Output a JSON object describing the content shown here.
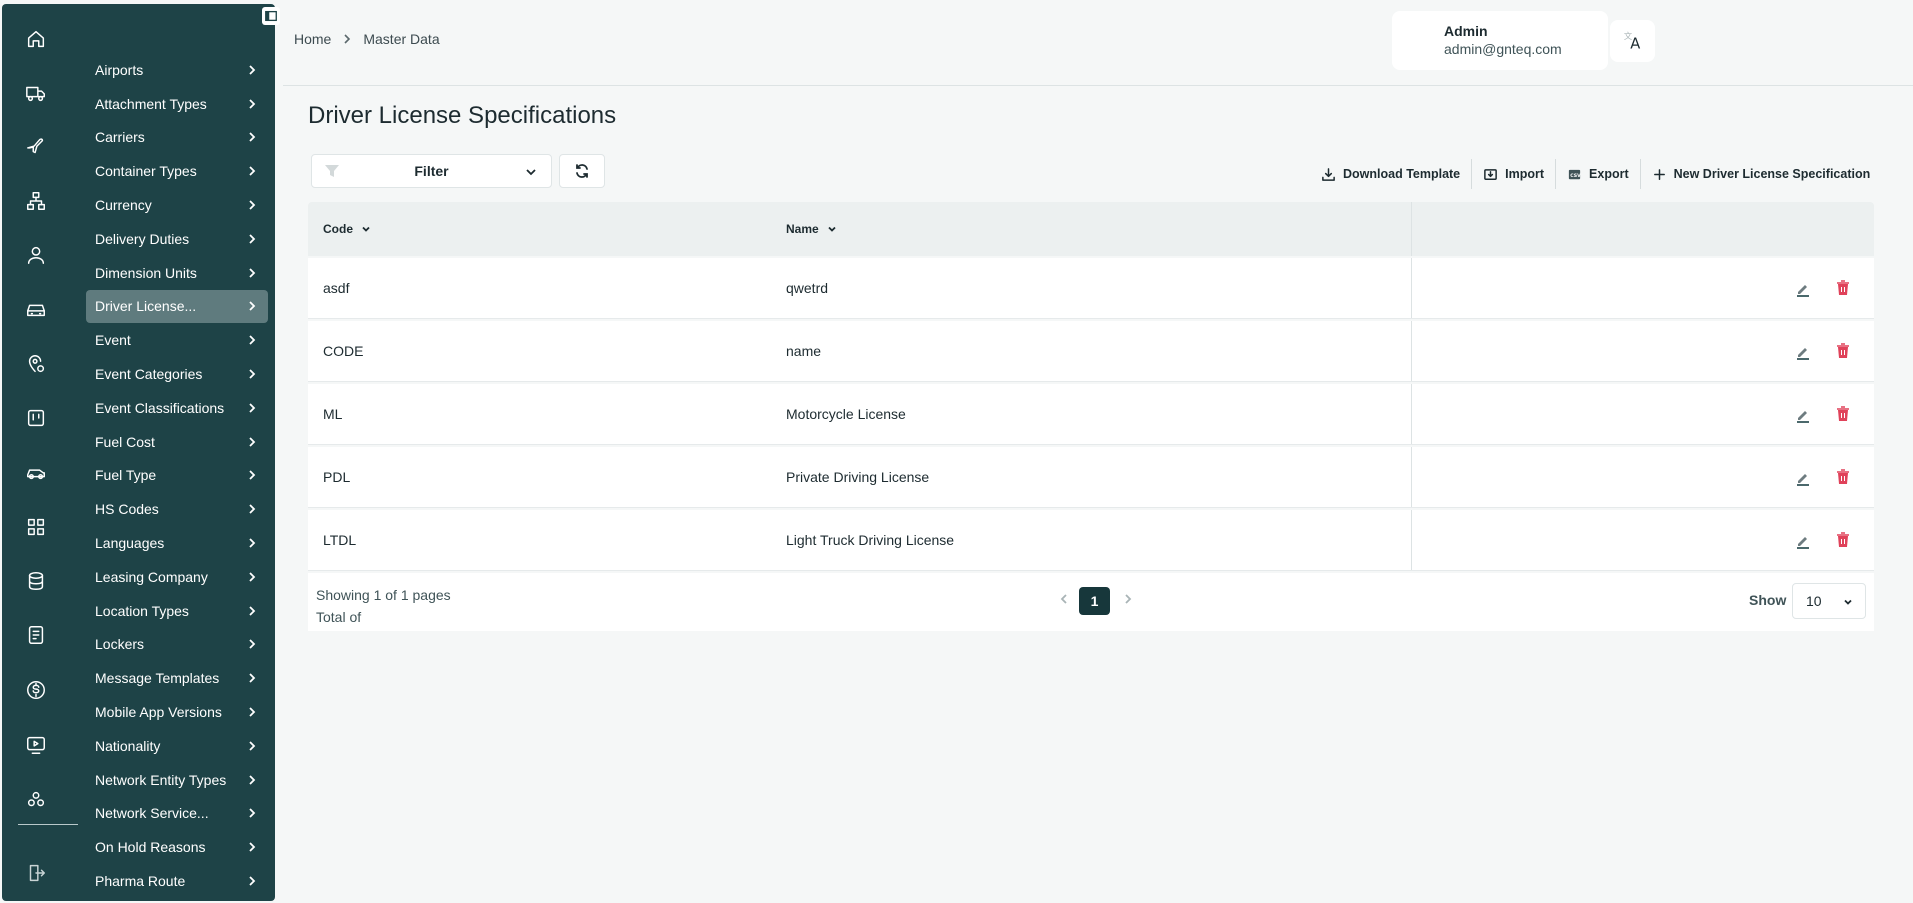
{
  "breadcrumb": {
    "home": "Home",
    "current": "Master Data"
  },
  "user": {
    "name": "Admin",
    "email": "admin@gnteq.com"
  },
  "sidebar": {
    "items": [
      {
        "label": "Airports"
      },
      {
        "label": "Attachment Types"
      },
      {
        "label": "Carriers"
      },
      {
        "label": "Container Types"
      },
      {
        "label": "Currency"
      },
      {
        "label": "Delivery Duties"
      },
      {
        "label": "Dimension Units"
      },
      {
        "label": "Driver License..."
      },
      {
        "label": "Event"
      },
      {
        "label": "Event Categories"
      },
      {
        "label": "Event Classifications"
      },
      {
        "label": "Fuel Cost"
      },
      {
        "label": "Fuel Type"
      },
      {
        "label": "HS Codes"
      },
      {
        "label": "Languages"
      },
      {
        "label": "Leasing Company"
      },
      {
        "label": "Location Types"
      },
      {
        "label": "Lockers"
      },
      {
        "label": "Message Templates"
      },
      {
        "label": "Mobile App Versions"
      },
      {
        "label": "Nationality"
      },
      {
        "label": "Network Entity Types"
      },
      {
        "label": "Network Service..."
      },
      {
        "label": "On Hold Reasons"
      },
      {
        "label": "Pharma Route"
      }
    ],
    "active_index": 7,
    "rail_icons": [
      "home-icon",
      "truck-icon",
      "plane-icon",
      "network-icon",
      "user-icon",
      "vehicle-front-icon",
      "location-settings-icon",
      "board-icon",
      "car-icon",
      "grid-icon",
      "database-icon",
      "document-icon",
      "dollar-icon",
      "monitor-play-icon",
      "cluster-icon",
      "logout-icon"
    ]
  },
  "page": {
    "title": "Driver License Specifications"
  },
  "toolbar": {
    "filter_label": "Filter",
    "download_template": "Download Template",
    "import": "Import",
    "export": "Export",
    "new_item": "New Driver License Specification"
  },
  "table": {
    "headers": {
      "code": "Code",
      "name": "Name"
    },
    "rows": [
      {
        "code": "asdf",
        "name": "qwetrd"
      },
      {
        "code": "CODE",
        "name": "name"
      },
      {
        "code": "ML",
        "name": "Motorcycle License"
      },
      {
        "code": "PDL",
        "name": "Private Driving License"
      },
      {
        "code": "LTDL",
        "name": "Light Truck Driving License"
      }
    ]
  },
  "pagination": {
    "showing": "Showing 1 of 1 pages",
    "total": "Total of",
    "current_page": "1",
    "show_label": "Show",
    "page_size": "10"
  },
  "colors": {
    "sidebar": "#1e4347",
    "active_item": "#5f7b7e",
    "accent": "#17373b",
    "delete": "#e0425a"
  }
}
